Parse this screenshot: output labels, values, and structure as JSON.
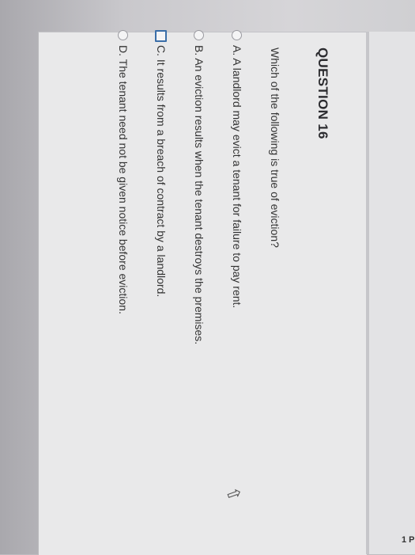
{
  "question": {
    "title": "QUESTION 16",
    "text": "Which of the following is true of eviction?",
    "options": [
      {
        "label": "A. A landlord may evict a tenant for failure to pay rent.",
        "control": "radio"
      },
      {
        "label": "B. An eviction results when the tenant destroys the premises.",
        "control": "radio"
      },
      {
        "label": "C. It results from a breach of contract by a landlord.",
        "control": "checkbox"
      },
      {
        "label": "D. The tenant need not be given notice before eviction.",
        "control": "radio"
      }
    ]
  },
  "points": "1 P",
  "colors": {
    "accent": "#3a6ea8",
    "card": "#e9e9ea"
  },
  "icons": {
    "cursor": "mouse-pointer-icon"
  }
}
